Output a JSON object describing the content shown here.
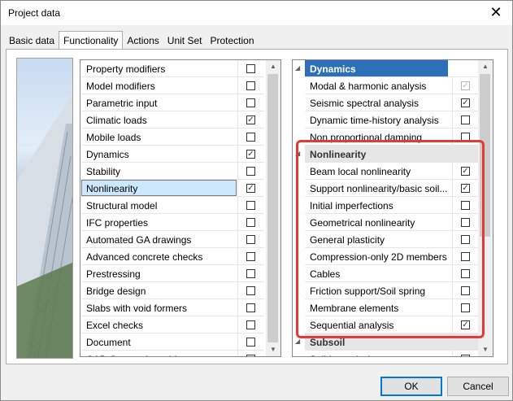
{
  "window": {
    "title": "Project data",
    "close_glyph": "✕"
  },
  "tabs": [
    {
      "label": "Basic data",
      "active": false
    },
    {
      "label": "Functionality",
      "active": true
    },
    {
      "label": "Actions",
      "active": false
    },
    {
      "label": "Unit Set",
      "active": false
    },
    {
      "label": "Protection",
      "active": false
    }
  ],
  "left_list": {
    "items": [
      {
        "label": "Property modifiers",
        "checked": false
      },
      {
        "label": "Model modifiers",
        "checked": false
      },
      {
        "label": "Parametric input",
        "checked": false
      },
      {
        "label": "Climatic loads",
        "checked": true
      },
      {
        "label": "Mobile loads",
        "checked": false
      },
      {
        "label": "Dynamics",
        "checked": true
      },
      {
        "label": "Stability",
        "checked": false
      },
      {
        "label": "Nonlinearity",
        "checked": true,
        "selected": true
      },
      {
        "label": "Structural model",
        "checked": false
      },
      {
        "label": "IFC properties",
        "checked": false
      },
      {
        "label": "Automated GA drawings",
        "checked": false
      },
      {
        "label": "Advanced concrete checks",
        "checked": false
      },
      {
        "label": "Prestressing",
        "checked": false
      },
      {
        "label": "Bridge design",
        "checked": false
      },
      {
        "label": "Slabs with void formers",
        "checked": false
      },
      {
        "label": "Excel checks",
        "checked": false
      },
      {
        "label": "Document",
        "checked": false
      },
      {
        "label": "CAD Composite cables",
        "checked": false
      }
    ]
  },
  "right_list": {
    "items": [
      {
        "label": "Dynamics",
        "type": "header-blue"
      },
      {
        "label": "Modal & harmonic analysis",
        "checked": true,
        "disabled": true
      },
      {
        "label": "Seismic spectral analysis",
        "checked": true
      },
      {
        "label": "Dynamic time-history analysis",
        "checked": false
      },
      {
        "label": "Non proportional damping",
        "checked": false
      },
      {
        "label": "Nonlinearity",
        "type": "header-grey"
      },
      {
        "label": "Beam local nonlinearity",
        "checked": true
      },
      {
        "label": "Support nonlinearity/basic soil...",
        "checked": true
      },
      {
        "label": "Initial imperfections",
        "checked": false
      },
      {
        "label": "Geometrical nonlinearity",
        "checked": false
      },
      {
        "label": "General plasticity",
        "checked": false
      },
      {
        "label": "Compression-only 2D members",
        "checked": false
      },
      {
        "label": "Cables",
        "checked": false
      },
      {
        "label": "Friction support/Soil spring",
        "checked": false
      },
      {
        "label": "Membrane elements",
        "checked": false
      },
      {
        "label": "Sequential analysis",
        "checked": true
      },
      {
        "label": "Subsoil",
        "type": "header-grey"
      },
      {
        "label": "Soil-in analysis",
        "checked": false
      }
    ]
  },
  "buttons": {
    "ok": "OK",
    "cancel": "Cancel"
  },
  "icons": {
    "check": "✓",
    "arrow_up": "▲",
    "arrow_down": "▼",
    "collapse": "◢"
  },
  "colors": {
    "highlight": "#e53935",
    "header_blue": "#2d6fb9",
    "selection": "#cce8ff"
  }
}
